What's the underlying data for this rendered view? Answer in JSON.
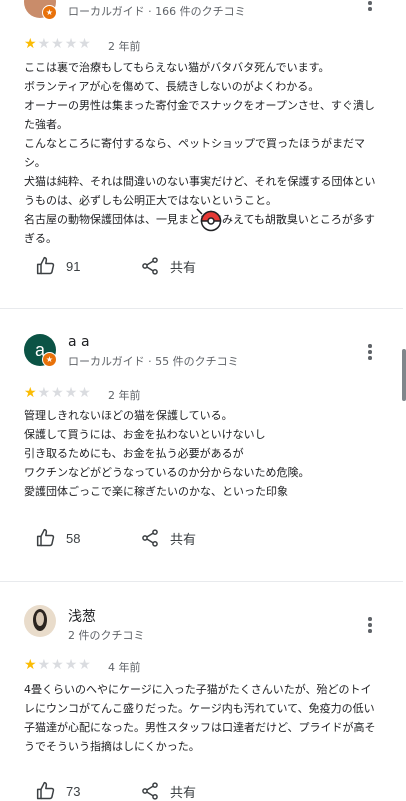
{
  "reviews": [
    {
      "meta": "ローカルガイド · 166 件のクチコミ",
      "rating": 1,
      "date": "2 年前",
      "lines": [
        "ここは裏で治療もしてもらえない猫がバタバタ死んでいます。",
        "ボランティアが心を傷めて、長続きしないのがよくわかる。",
        "オーナーの男性は集まった寄付金でスナックをオープンさせ、すぐ潰した強者。",
        "こんなところに寄付するなら、ペットショップで買ったほうがまだマシ。",
        "犬猫は純粋、それは間違いのない事実だけど、それを保護する団体というものは、必ずしも公明正大ではないということ。",
        "名古屋の動物保護団体は、一見まともにみえても胡散臭いところが多すぎる。"
      ],
      "likes": "91",
      "share": "共有"
    },
    {
      "avatar_letter": "a",
      "name": "a a",
      "meta": "ローカルガイド · 55 件のクチコミ",
      "rating": 1,
      "date": "2 年前",
      "lines": [
        "管理しきれないほどの猫を保護している。",
        "保護して買うには、お金を払わないといけないし",
        "引き取るためにも、お金を払う必要があるが",
        "ワクチンなどがどうなっているのか分からないため危険。",
        "愛護団体ごっこで楽に稼ぎたいのかな、といった印象"
      ],
      "likes": "58",
      "share": "共有"
    },
    {
      "name": "浅葱",
      "meta": "2 件のクチコミ",
      "rating": 1,
      "date": "4 年前",
      "lines": [
        "4畳くらいのへやにケージに入った子猫がたくさんいたが、殆どのトイレにウンコがてんこ盛りだった。ケージ内も汚れていて、免疫力の低い子猫達が心配になった。男性スタッフは口達者だけど、プライドが高そうでそういう指摘はしにくかった。"
      ],
      "likes": "73",
      "share": "共有"
    }
  ],
  "icons": {
    "like": "thumbs-up-icon",
    "share": "share-icon",
    "more": "more-vert-icon",
    "badge": "local-guide-star-icon",
    "cursor": "poke-ball-cursor-icon"
  },
  "colors": {
    "star_on": "#fbbc04",
    "star_off": "#dadce0",
    "avatar_a": "#0b5345",
    "badge": "#e8710a"
  }
}
